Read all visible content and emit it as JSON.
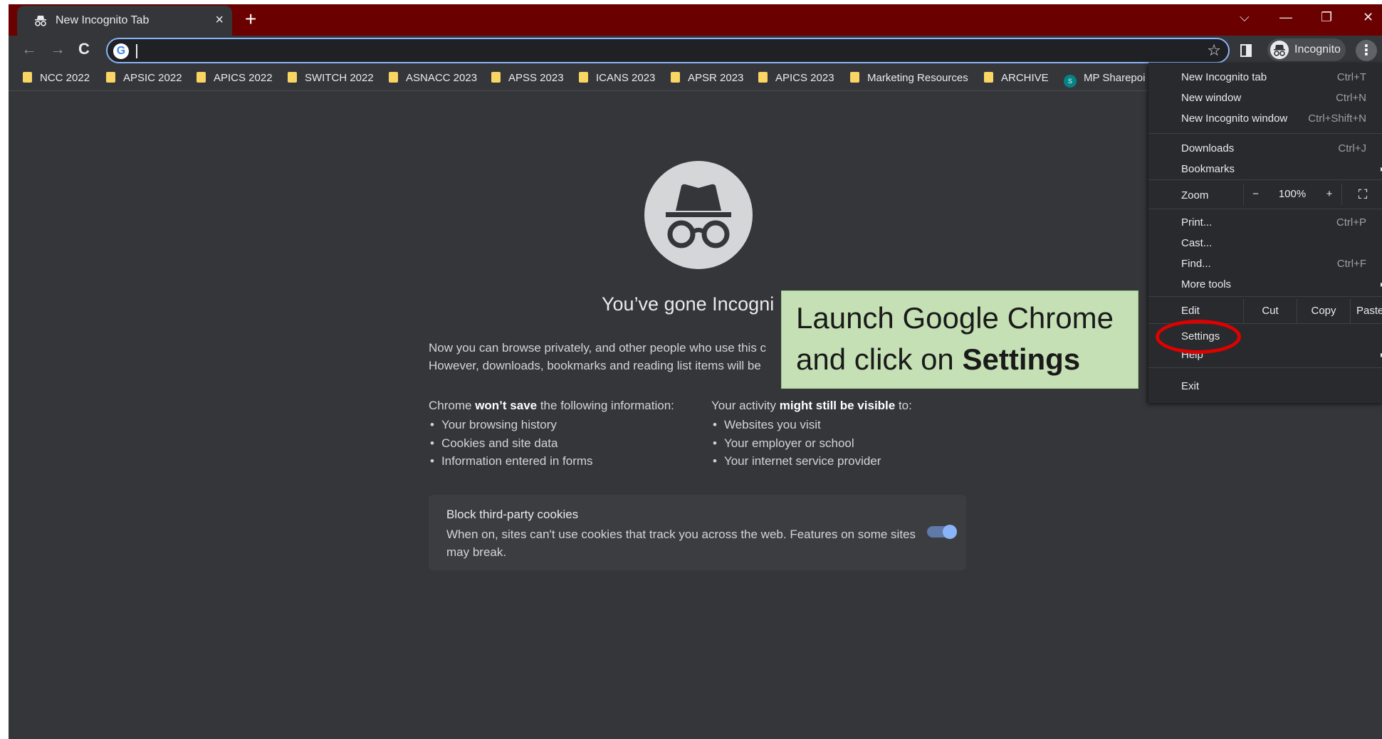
{
  "tab": {
    "title": "New Incognito Tab",
    "close": "×"
  },
  "new_tab": "+",
  "window_controls": {
    "dropdown": "⌵",
    "minimize": "—",
    "restore": "❐",
    "close": "✕"
  },
  "toolbar": {
    "back": "←",
    "forward": "→",
    "reload": "C",
    "star": "☆",
    "profile_label": "Incognito",
    "menu": "⋮"
  },
  "omnibox": {
    "logo": "G",
    "value": ""
  },
  "bookmarks": [
    {
      "label": "NCC 2022",
      "icon": "folder-icon"
    },
    {
      "label": "APSIC 2022",
      "icon": "folder-icon"
    },
    {
      "label": "APICS 2022",
      "icon": "folder-icon"
    },
    {
      "label": "SWITCH 2022",
      "icon": "folder-icon"
    },
    {
      "label": "ASNACC 2023",
      "icon": "folder-icon"
    },
    {
      "label": "APSS 2023",
      "icon": "folder-icon"
    },
    {
      "label": "ICANS 2023",
      "icon": "folder-icon"
    },
    {
      "label": "APSR 2023",
      "icon": "folder-icon"
    },
    {
      "label": "APICS 2023",
      "icon": "folder-icon"
    },
    {
      "label": "Marketing Resources",
      "icon": "folder-icon"
    },
    {
      "label": "ARCHIVE",
      "icon": "folder-icon"
    },
    {
      "label": "MP Sharepoi",
      "icon": "sharepoint-icon",
      "icon_text": "S"
    }
  ],
  "page": {
    "title": "You’ve gone Incogni",
    "para1": "Now you can browse privately, and other people who use this c",
    "para2": "However, downloads, bookmarks and reading list items will be",
    "col1": {
      "title_pre": "Chrome ",
      "title_bold": "won’t save",
      "title_post": " the following information:",
      "items": [
        "Your browsing history",
        "Cookies and site data",
        "Information entered in forms"
      ]
    },
    "col2": {
      "title_pre": "Your activity ",
      "title_bold": "might still be visible",
      "title_post": " to:",
      "items": [
        "Websites you visit",
        "Your employer or school",
        "Your internet service provider"
      ]
    },
    "cookies": {
      "title": "Block third-party cookies",
      "desc": "When on, sites can't use cookies that track you across the web. Features on some sites may break.",
      "enabled": true
    }
  },
  "callout": {
    "line1": "Launch Google Chrome",
    "line2_pre": "and click on ",
    "line2_bold": "Settings"
  },
  "menu": {
    "new_incognito_tab": {
      "label": "New Incognito tab",
      "shortcut": "Ctrl+T"
    },
    "new_window": {
      "label": "New window",
      "shortcut": "Ctrl+N"
    },
    "new_incognito_window": {
      "label": "New Incognito window",
      "shortcut": "Ctrl+Shift+N"
    },
    "downloads": {
      "label": "Downloads",
      "shortcut": "Ctrl+J"
    },
    "bookmarks": {
      "label": "Bookmarks"
    },
    "zoom": {
      "label": "Zoom",
      "minus": "−",
      "value": "100%",
      "plus": "+",
      "fullscreen": "⛶"
    },
    "print": {
      "label": "Print...",
      "shortcut": "Ctrl+P"
    },
    "cast": {
      "label": "Cast..."
    },
    "find": {
      "label": "Find...",
      "shortcut": "Ctrl+F"
    },
    "more_tools": {
      "label": "More tools"
    },
    "edit": {
      "label": "Edit",
      "cut": "Cut",
      "copy": "Copy",
      "paste": "Paste"
    },
    "settings": {
      "label": "Settings"
    },
    "help": {
      "label": "Help"
    },
    "exit": {
      "label": "Exit"
    },
    "arrow": "▸"
  },
  "colors": {
    "frame": "#6b0000",
    "toolbar": "#35363a",
    "page_bg": "#35363a",
    "menu_bg": "#292a2d",
    "accent": "#8ab4f8",
    "callout_bg": "#c5e0b4",
    "highlight_circle": "#e00000"
  }
}
